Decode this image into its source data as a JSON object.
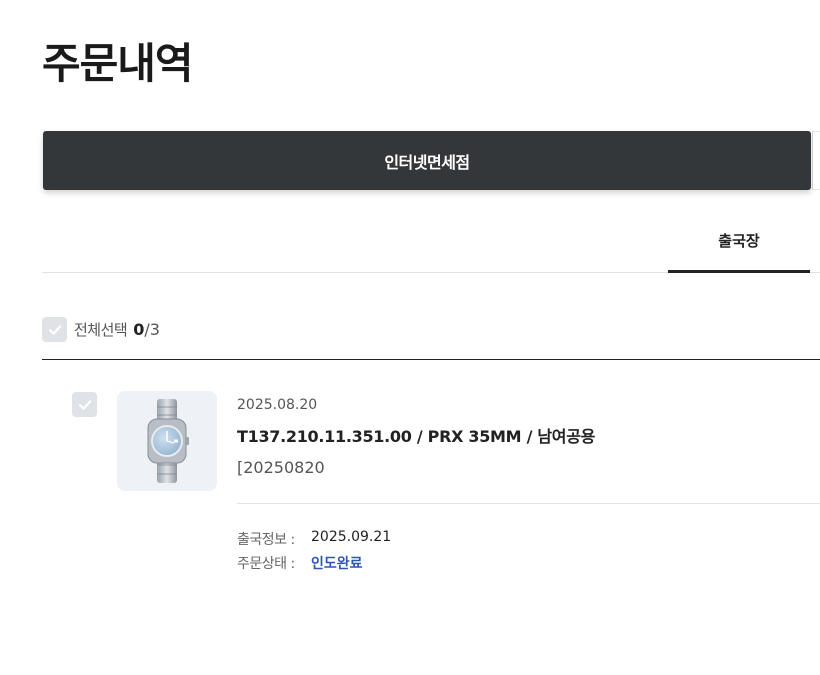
{
  "page": {
    "title": "주문내역"
  },
  "store_tab": {
    "label": "인터넷면세점"
  },
  "sub_tab": {
    "label": "출국장"
  },
  "select_all": {
    "label": "전체선택",
    "selected": "0",
    "total": "/3"
  },
  "order": {
    "date": "2025.08.20",
    "product_name": "T137.210.11.351.00 / PRX 35MM / 남여공용",
    "code": "[20250820",
    "departure_label": "출국정보 :",
    "departure_value": "2025.09.21",
    "status_label": "주문상태 :",
    "status_value": "인도완료",
    "thumbnail_icon": "watch-icon"
  },
  "colors": {
    "tab_bg": "#34373a",
    "status": "#2f56b4",
    "checkbox": "#dfe2e6"
  }
}
